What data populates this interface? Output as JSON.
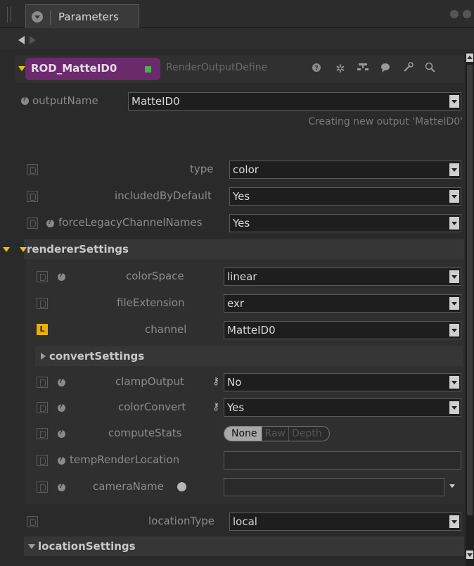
{
  "window": {
    "tab_title": "Parameters"
  },
  "node": {
    "name": "ROD_MatteID0",
    "type": "RenderOutputDefine"
  },
  "outputName": {
    "label": "outputName",
    "value": "MatteID0",
    "message": "Creating new output 'MatteID0'"
  },
  "params": {
    "type": {
      "label": "type",
      "value": "color"
    },
    "includedByDefault": {
      "label": "includedByDefault",
      "value": "Yes"
    },
    "forceLegacyChannelNames": {
      "label": "forceLegacyChannelNames",
      "value": "Yes"
    }
  },
  "rendererSettings": {
    "title": "rendererSettings",
    "colorSpace": {
      "label": "colorSpace",
      "value": "linear"
    },
    "fileExtension": {
      "label": "fileExtension",
      "value": "exr"
    },
    "channel": {
      "label": "channel",
      "value": "MatteID0",
      "badge": "L"
    }
  },
  "convertSettings": {
    "title": "convertSettings",
    "clampOutput": {
      "label": "clampOutput",
      "value": "No"
    },
    "colorConvert": {
      "label": "colorConvert",
      "value": "Yes"
    },
    "computeStats": {
      "label": "computeStats",
      "options": [
        "None",
        "Raw",
        "Depth"
      ],
      "selected": "None"
    },
    "tempRenderLocation": {
      "label": "tempRenderLocation",
      "value": ""
    },
    "cameraName": {
      "label": "cameraName",
      "value": ""
    }
  },
  "locationType": {
    "label": "locationType",
    "value": "local"
  },
  "locationSettings": {
    "title": "locationSettings"
  },
  "colors": {
    "node_pill": "#6b2a6b",
    "accent": "#f0c000",
    "green": "#4caf50"
  }
}
